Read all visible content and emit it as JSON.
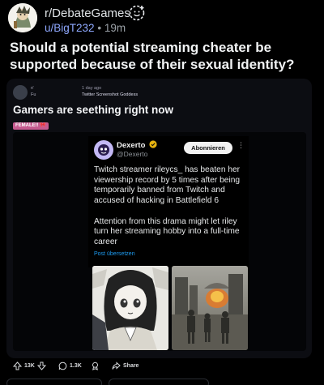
{
  "post": {
    "subreddit": "r/DebateGames",
    "author": "u/BigT232",
    "separator": "•",
    "age": "19m",
    "title": "Should a potential streaming cheater be supported because of their sexual identity?"
  },
  "embedded_post": {
    "mini_user": "r/",
    "mini_flair": "Fu",
    "mini_age": "1 day ago",
    "mini_sub": "Twitter Screenshot Goddess",
    "title": "Gamers are seething right now",
    "flair": "FEMALE!! 🎀"
  },
  "tweet": {
    "name": "Dexerto",
    "handle": "@Dexerto",
    "follow_label": "Abonnieren",
    "more": "⋮",
    "paragraph1": "Twitch streamer rileycs_ has beaten her viewership record by 5 times after being temporarily banned from Twitch and accused of hacking in Battlefield 6",
    "paragraph2": "Attention from this drama might let riley turn her streaming hobby into a full-time career",
    "translate": "Post übersetzen"
  },
  "actions": {
    "upvotes": "13K",
    "comments": "1.3K",
    "share": "Share"
  },
  "colors": {
    "background": "#000000",
    "link_blue": "#8fa9ff",
    "twitter_blue": "#1d9bf0",
    "flair_pink": "#c55a8f"
  },
  "icons": [
    "join-icon",
    "verified-icon",
    "upvote-icon",
    "downvote-icon",
    "comment-icon",
    "award-icon",
    "share-icon"
  ]
}
